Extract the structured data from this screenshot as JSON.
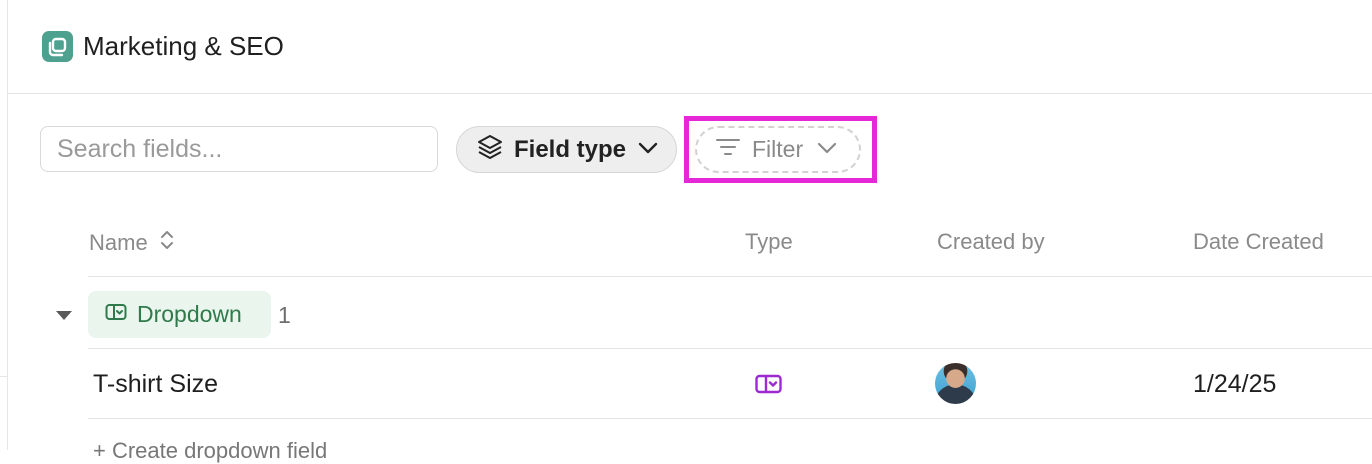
{
  "header": {
    "title": "Marketing & SEO",
    "icon": "space-icon"
  },
  "toolbar": {
    "search_placeholder": "Search fields...",
    "field_type_label": "Field type",
    "filter_label": "Filter"
  },
  "table": {
    "columns": [
      "Name",
      "Type",
      "Created by",
      "Date Created"
    ],
    "groups": [
      {
        "label": "Dropdown",
        "count": "1",
        "rows": [
          {
            "name": "T-shirt Size",
            "type_icon": "dropdown-field-icon",
            "created_by": "avatar",
            "date_created": "1/24/25"
          }
        ]
      }
    ],
    "create_row_label": "+ Create dropdown field"
  },
  "colors": {
    "accent_green": "#4ea18e",
    "group_text": "#2f7a4a",
    "group_bg": "#eaf5ee",
    "type_icon": "#9b2bd1",
    "highlight": "#e627d8"
  }
}
